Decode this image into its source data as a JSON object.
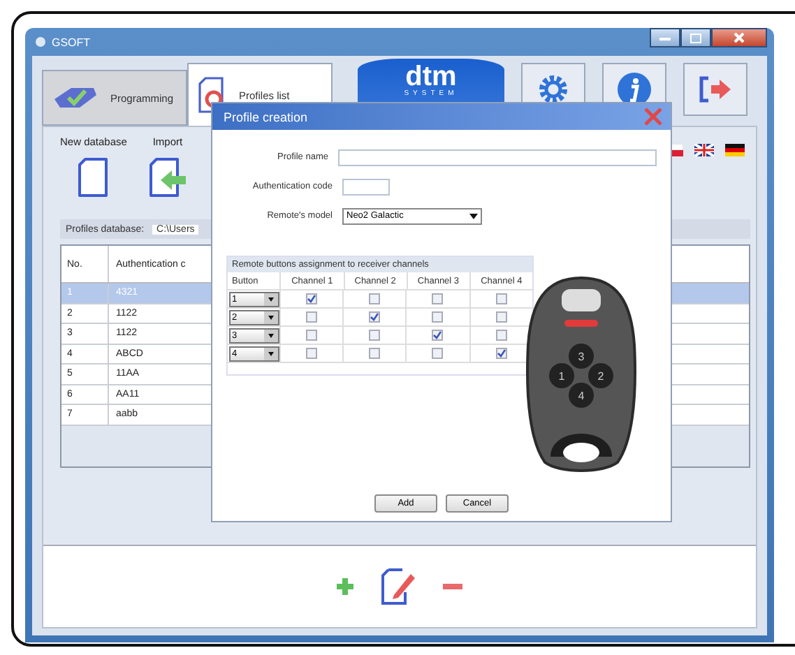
{
  "window": {
    "title": "GSOFT"
  },
  "tabs": [
    {
      "label": "Programming",
      "selected": false,
      "kind": "programming"
    },
    {
      "label": "Profiles list",
      "selected": true,
      "kind": "profiles"
    }
  ],
  "logo": {
    "mark": "dtm",
    "tagline": "SYSTEM"
  },
  "toolbar": [
    {
      "label": "New database",
      "kind": "new"
    },
    {
      "label": "Import",
      "kind": "import"
    }
  ],
  "database": {
    "label": "Profiles database:",
    "path": "C:\\Users"
  },
  "profiles": {
    "columns": [
      "No.",
      "Authentication c"
    ],
    "rows": [
      {
        "no": "1",
        "code": "4321",
        "selected": true
      },
      {
        "no": "2",
        "code": "1122",
        "selected": false
      },
      {
        "no": "3",
        "code": "1122",
        "selected": false
      },
      {
        "no": "4",
        "code": "ABCD",
        "selected": false
      },
      {
        "no": "5",
        "code": "11AA",
        "selected": false
      },
      {
        "no": "6",
        "code": "AA11",
        "selected": false
      },
      {
        "no": "7",
        "code": "aabb",
        "selected": false
      }
    ]
  },
  "dialog": {
    "title": "Profile creation",
    "fields": [
      {
        "label": "Profile name",
        "kind": "wide"
      },
      {
        "label": "Authentication code",
        "kind": "short"
      },
      {
        "label": "Remote's model",
        "kind": "select",
        "value": "Neo2 Galactic"
      }
    ],
    "assignment": {
      "caption": "Remote buttons assignment to receiver channels",
      "columns": [
        "Button",
        "Channel 1",
        "Channel 2",
        "Channel 3",
        "Channel 4"
      ],
      "rows": [
        {
          "button": "1",
          "channels": [
            true,
            false,
            false,
            false
          ]
        },
        {
          "button": "2",
          "channels": [
            false,
            true,
            false,
            false
          ]
        },
        {
          "button": "3",
          "channels": [
            false,
            false,
            true,
            false
          ]
        },
        {
          "button": "4",
          "channels": [
            false,
            false,
            false,
            true
          ]
        }
      ]
    },
    "remote_keys": [
      "1",
      "2",
      "3",
      "4"
    ],
    "buttons": [
      "Add",
      "Cancel"
    ]
  }
}
